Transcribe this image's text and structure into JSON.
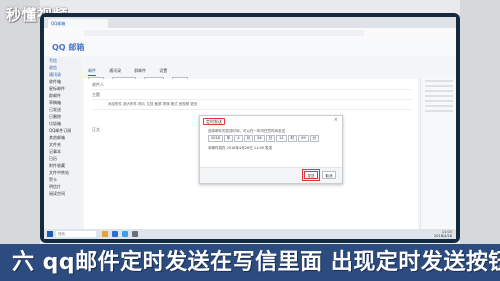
{
  "watermark": {
    "text": "秒懂视频"
  },
  "browser": {
    "tab_title": "QQ邮箱"
  },
  "mail": {
    "logo_main": "QQ",
    "logo_sub": "邮箱"
  },
  "top_tabs": [
    "邮件",
    "通讯录",
    "群邮件",
    "设置"
  ],
  "toolbar": [
    "发送",
    "定时发送",
    "存草稿",
    "关闭"
  ],
  "sidebar": [
    "写信",
    "收信",
    "通讯录",
    "收件箱",
    "星标邮件",
    "群邮件",
    "草稿箱",
    "已发送",
    "已删除",
    "垃圾箱",
    "QQ邮件订阅",
    "其他邮箱",
    "文件夹",
    "记事本",
    "日历",
    "附件收藏",
    "文件中转站",
    "贺卡",
    "明信片",
    "阅读空间"
  ],
  "compose": {
    "to_label": "收件人",
    "subject_label": "主题",
    "body_label": "正文",
    "attach_bar": "添加附件  超大附件  照片  文档  截屏  表情  格式  音视频  更多"
  },
  "dialog": {
    "title": "定时发送",
    "close": "×",
    "desc": "选择邮件的发送时间，可以在一年内任意时间发送",
    "selects": [
      "2018",
      "年",
      "4",
      "月",
      "26",
      "日",
      "11",
      "时",
      "09",
      "分"
    ],
    "info": "本邮件将在 2018年4月26日 11:09 发送",
    "send_label": "发送",
    "cancel_label": "取消"
  },
  "taskbar": {
    "search": "搜索",
    "time": "11:03",
    "date": "2018/4/26"
  },
  "caption": {
    "text": "六 qq邮件定时发送在写信里面  出现定时发送按钮"
  }
}
